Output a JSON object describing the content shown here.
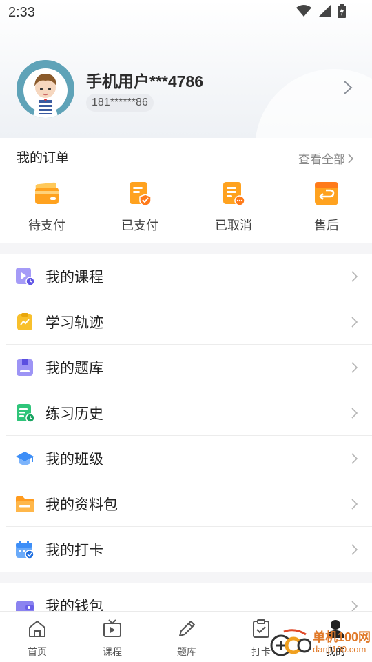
{
  "status_bar": {
    "time": "2:33"
  },
  "profile": {
    "name": "手机用户***4786",
    "phone": "181******86"
  },
  "orders": {
    "title": "我的订单",
    "view_all": "查看全部",
    "items": [
      {
        "label": "待支付",
        "icon": "wallet-icon"
      },
      {
        "label": "已支付",
        "icon": "paid-document-icon"
      },
      {
        "label": "已取消",
        "icon": "cancelled-document-icon"
      },
      {
        "label": "售后",
        "icon": "after-sales-return-icon"
      }
    ]
  },
  "menu": {
    "items": [
      {
        "label": "我的课程",
        "icon": "course-play-icon"
      },
      {
        "label": "学习轨迹",
        "icon": "learning-track-icon"
      },
      {
        "label": "我的题库",
        "icon": "question-bank-icon"
      },
      {
        "label": "练习历史",
        "icon": "practice-history-icon"
      },
      {
        "label": "我的班级",
        "icon": "graduation-cap-icon"
      },
      {
        "label": "我的资料包",
        "icon": "folder-icon"
      },
      {
        "label": "我的打卡",
        "icon": "calendar-check-icon"
      }
    ],
    "extra": {
      "label": "我的钱包",
      "icon": "wallet-purse-icon"
    }
  },
  "tabbar": {
    "tabs": [
      {
        "label": "首页",
        "icon": "home-icon"
      },
      {
        "label": "课程",
        "icon": "tv-play-icon"
      },
      {
        "label": "题库",
        "icon": "pencil-icon"
      },
      {
        "label": "打卡",
        "icon": "clipboard-check-icon"
      },
      {
        "label": "我的",
        "icon": "person-icon",
        "active": true
      }
    ]
  },
  "watermark": {
    "name": "单机100网",
    "url": "danji100.com"
  },
  "colors": {
    "accent_orange": "#ffa21f",
    "purple": "#8b83f0",
    "yellow": "#f8c02c",
    "green": "#2fc57a",
    "blue": "#3d8ef7"
  }
}
